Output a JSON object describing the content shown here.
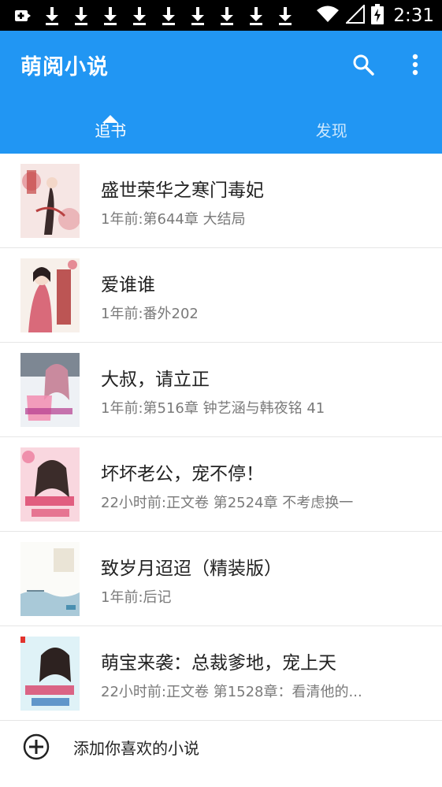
{
  "statusbar": {
    "time": "2:31",
    "icons": [
      "notification-icon",
      "download-icon",
      "download-icon",
      "download-icon",
      "download-icon",
      "download-icon",
      "download-icon",
      "download-icon",
      "download-icon",
      "download-icon",
      "wifi-icon",
      "signal-icon",
      "battery-icon"
    ]
  },
  "appbar": {
    "title": "萌阅小说",
    "color": "#2196f3",
    "search_icon": "search-icon",
    "more_icon": "more-vert-icon"
  },
  "tabs": [
    {
      "label": "追书",
      "active": true
    },
    {
      "label": "发现",
      "active": false
    }
  ],
  "books": [
    {
      "title": "盛世荣华之寒门毒妃",
      "update": "1年前:第644章 大结局"
    },
    {
      "title": "爱谁谁",
      "update": "1年前:番外202"
    },
    {
      "title": "大叔，请立正",
      "update": "1年前:第516章 钟艺涵与韩夜铭 41"
    },
    {
      "title": "坏坏老公，宠不停！",
      "update": "22小时前:正文卷 第2524章 不考虑换一"
    },
    {
      "title": "致岁月迢迢（精装版）",
      "update": "1年前:后记"
    },
    {
      "title": "萌宝来袭：总裁爹地，宠上天",
      "update": "22小时前:正文卷 第1528章：看清他的..."
    }
  ],
  "add_book": {
    "label": "添加你喜欢的小说",
    "icon": "add-circle-icon"
  }
}
